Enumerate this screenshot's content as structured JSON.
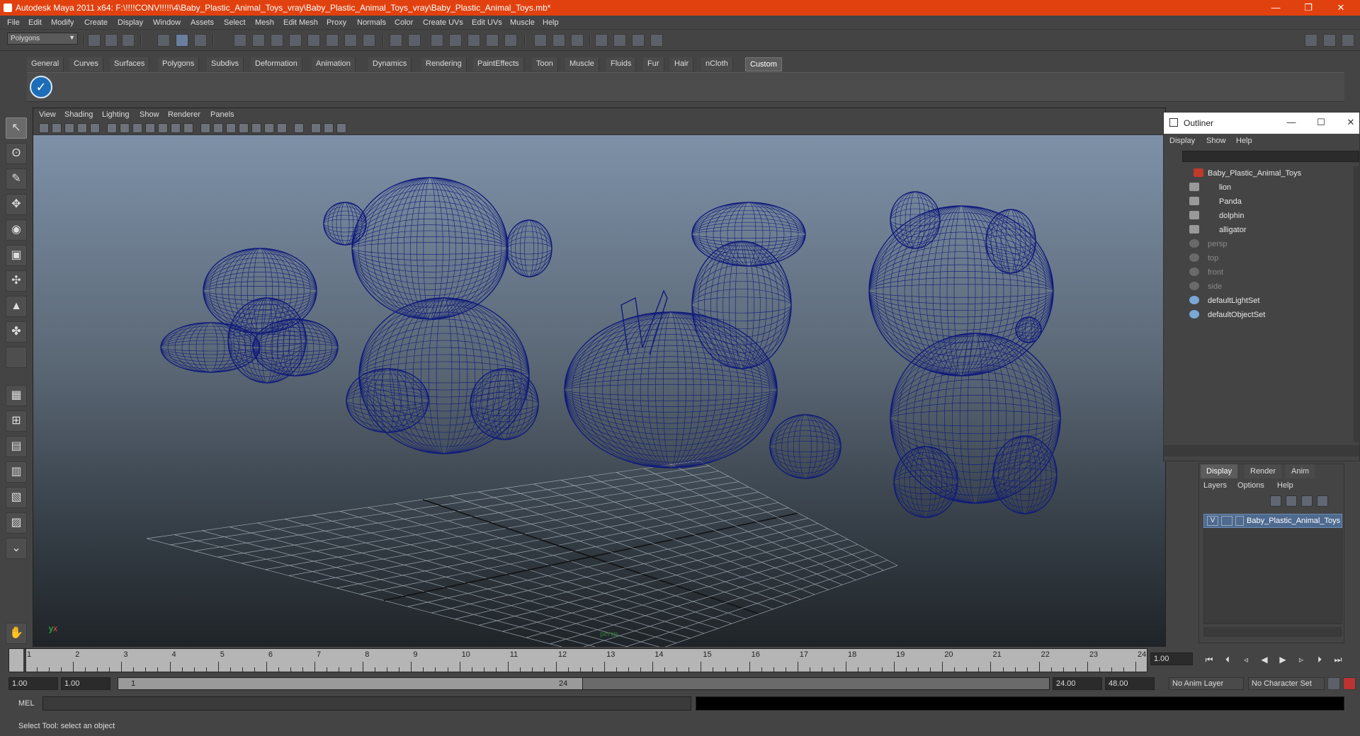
{
  "window": {
    "title": "Autodesk Maya 2011 x64: F:\\!!!!CONV!!!!!\\4\\Baby_Plastic_Animal_Toys_vray\\Baby_Plastic_Animal_Toys_vray\\Baby_Plastic_Animal_Toys.mb*",
    "minimize": "—",
    "restore": "❐",
    "close": "✕"
  },
  "menubar": [
    "File",
    "Edit",
    "Modify",
    "Create",
    "Display",
    "Window",
    "Assets",
    "Select",
    "Mesh",
    "Edit Mesh",
    "Proxy",
    "Normals",
    "Color",
    "Create UVs",
    "Edit UVs",
    "Muscle",
    "Help"
  ],
  "statusline": {
    "mode": "Polygons"
  },
  "shelf": {
    "tabs": [
      "General",
      "Curves",
      "Surfaces",
      "Polygons",
      "Subdivs",
      "Deformation",
      "Animation",
      "Dynamics",
      "Rendering",
      "PaintEffects",
      "Toon",
      "Muscle",
      "Fluids",
      "Fur",
      "Hair",
      "nCloth",
      "Custom"
    ],
    "active_tab": "Custom",
    "button_icon": "checkmark-icon"
  },
  "viewport": {
    "menu": [
      "View",
      "Shading",
      "Lighting",
      "Show",
      "Renderer",
      "Panels"
    ],
    "camera": "persp",
    "axis_y": "y",
    "axis_x": "x",
    "colors": {
      "wire": "#0f1a7a",
      "grid": "#9aa4ad"
    }
  },
  "outliner": {
    "title": "Outliner",
    "menu": [
      "Display",
      "Show",
      "Help"
    ],
    "items": [
      {
        "label": "Baby_Plastic_Animal_Toys",
        "dim": false,
        "indent": 0
      },
      {
        "label": "lion",
        "dim": false,
        "indent": 1
      },
      {
        "label": "Panda",
        "dim": false,
        "indent": 1
      },
      {
        "label": "dolphin",
        "dim": false,
        "indent": 1
      },
      {
        "label": "alligator",
        "dim": false,
        "indent": 1
      },
      {
        "label": "persp",
        "dim": true,
        "indent": 0
      },
      {
        "label": "top",
        "dim": true,
        "indent": 0
      },
      {
        "label": "front",
        "dim": true,
        "indent": 0
      },
      {
        "label": "side",
        "dim": true,
        "indent": 0
      },
      {
        "label": "defaultLightSet",
        "dim": false,
        "indent": 0
      },
      {
        "label": "defaultObjectSet",
        "dim": false,
        "indent": 0
      }
    ]
  },
  "layer_editor": {
    "tabs": [
      "Display",
      "Render",
      "Anim"
    ],
    "active_tab": "Display",
    "menu": [
      "Layers",
      "Options",
      "Help"
    ],
    "layer": {
      "visibility": "V",
      "name": "Baby_Plastic_Animal_Toys"
    }
  },
  "timeline": {
    "ticks": [
      "1",
      "2",
      "3",
      "4",
      "5",
      "6",
      "7",
      "8",
      "9",
      "10",
      "11",
      "12",
      "13",
      "14",
      "15",
      "16",
      "17",
      "18",
      "19",
      "20",
      "21",
      "22",
      "23",
      "24"
    ],
    "current": "1",
    "current_frame_field": "1.00"
  },
  "range": {
    "start": "1.00",
    "playback_start": "1.00",
    "range_start_label": "1",
    "range_end_label": "24",
    "playback_end": "24.00",
    "end": "48.00",
    "anim_layer": "No Anim Layer",
    "character_set": "No Character Set"
  },
  "cmdline": {
    "label": "MEL"
  },
  "helpline": {
    "text": "Select Tool: select an object"
  }
}
